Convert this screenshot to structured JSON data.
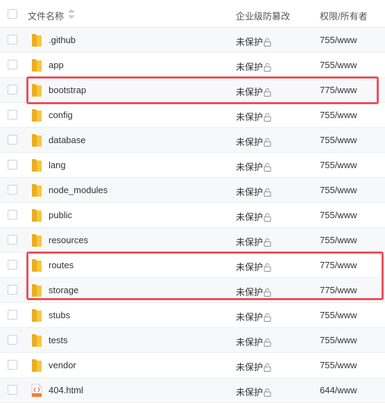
{
  "header": {
    "name_label": "文件名称",
    "protection_label": "企业级防篡改",
    "permission_label": "权限/所有者",
    "sort_icon": "sort-arrows-icon"
  },
  "rows": [
    {
      "name": ".github",
      "type": "folder",
      "protection": "未保护",
      "permission": "755/www",
      "highlighted": false
    },
    {
      "name": "app",
      "type": "folder",
      "protection": "未保护",
      "permission": "755/www",
      "highlighted": false
    },
    {
      "name": "bootstrap",
      "type": "folder",
      "protection": "未保护",
      "permission": "775/www",
      "highlighted": true
    },
    {
      "name": "config",
      "type": "folder",
      "protection": "未保护",
      "permission": "755/www",
      "highlighted": false
    },
    {
      "name": "database",
      "type": "folder",
      "protection": "未保护",
      "permission": "755/www",
      "highlighted": false
    },
    {
      "name": "lang",
      "type": "folder",
      "protection": "未保护",
      "permission": "755/www",
      "highlighted": false
    },
    {
      "name": "node_modules",
      "type": "folder",
      "protection": "未保护",
      "permission": "755/www",
      "highlighted": false
    },
    {
      "name": "public",
      "type": "folder",
      "protection": "未保护",
      "permission": "755/www",
      "highlighted": false
    },
    {
      "name": "resources",
      "type": "folder",
      "protection": "未保护",
      "permission": "755/www",
      "highlighted": false
    },
    {
      "name": "routes",
      "type": "folder",
      "protection": "未保护",
      "permission": "775/www",
      "highlighted": true
    },
    {
      "name": "storage",
      "type": "folder",
      "protection": "未保护",
      "permission": "775/www",
      "highlighted": true
    },
    {
      "name": "stubs",
      "type": "folder",
      "protection": "未保护",
      "permission": "755/www",
      "highlighted": false
    },
    {
      "name": "tests",
      "type": "folder",
      "protection": "未保护",
      "permission": "755/www",
      "highlighted": false
    },
    {
      "name": "vendor",
      "type": "folder",
      "protection": "未保护",
      "permission": "755/www",
      "highlighted": false
    },
    {
      "name": "404.html",
      "type": "html-file",
      "protection": "未保护",
      "permission": "644/www",
      "highlighted": false
    }
  ],
  "colors": {
    "highlight": "#e8505b",
    "folder": "#f8c63c",
    "folder_dark": "#e9ae22",
    "row_alt": "#f7f8fa"
  }
}
